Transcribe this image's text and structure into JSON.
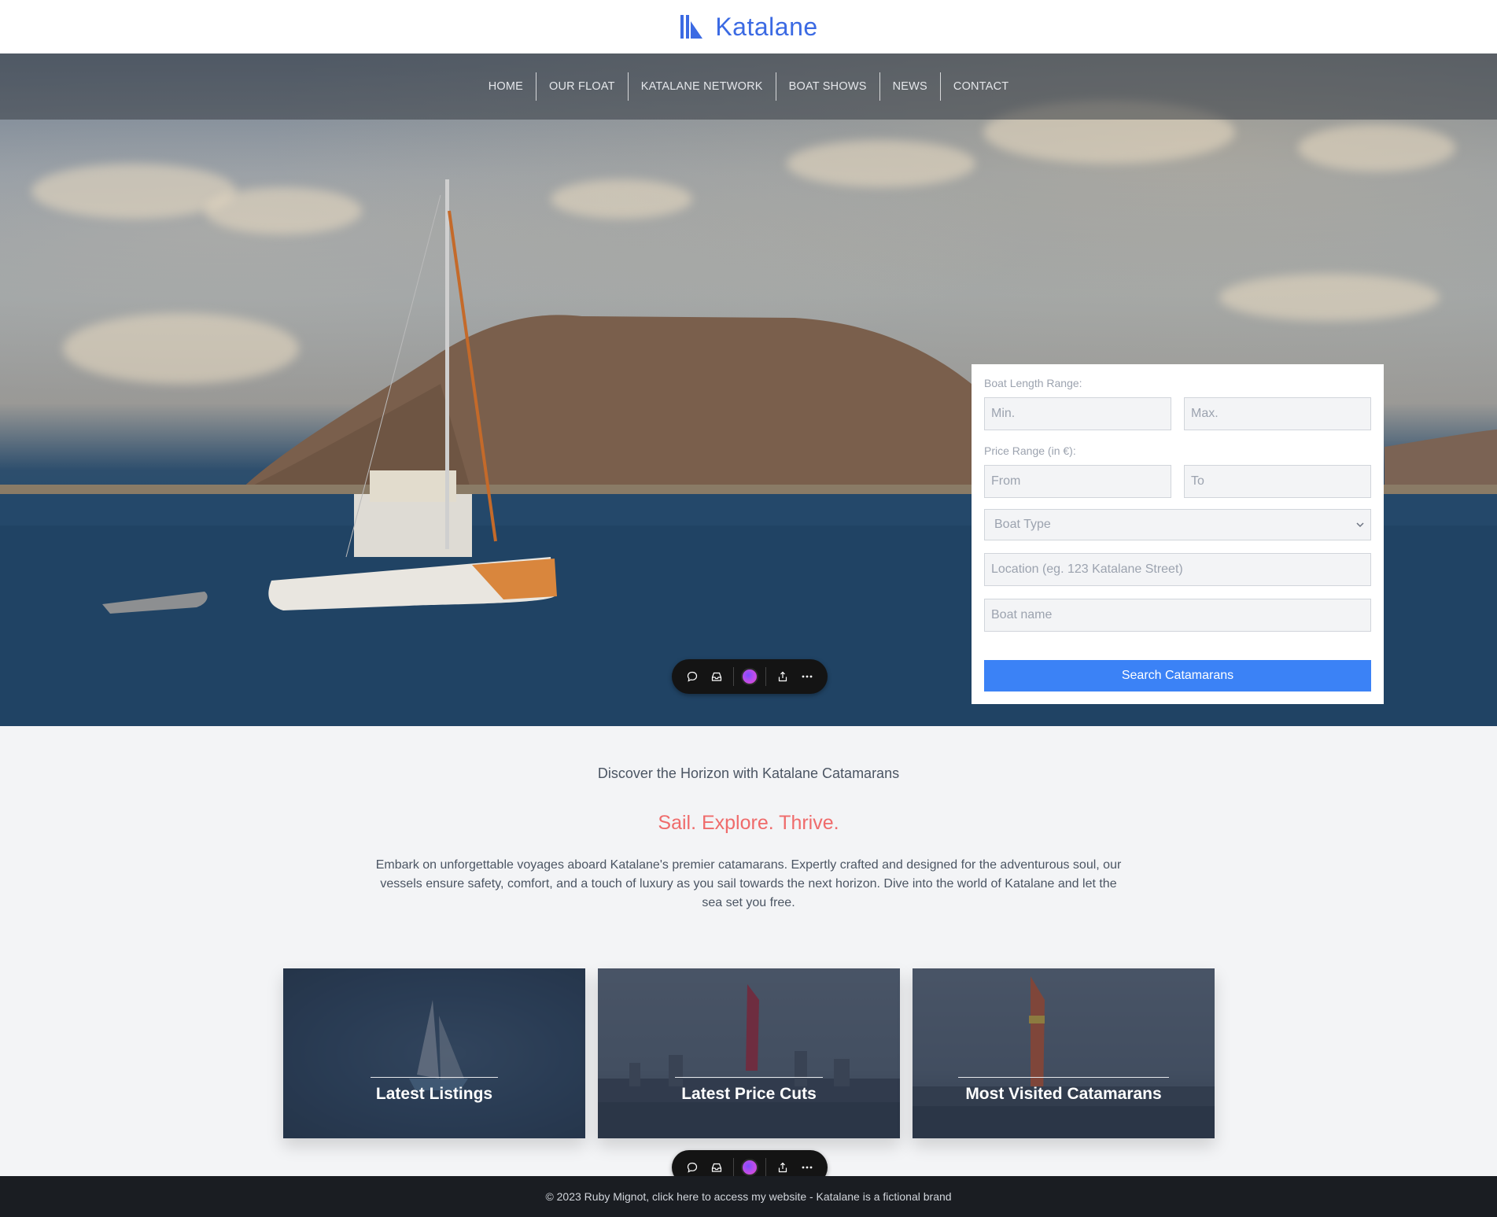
{
  "header": {
    "brand_name": "Katalane"
  },
  "nav": {
    "items": [
      {
        "label": "HOME"
      },
      {
        "label": "OUR FLOAT"
      },
      {
        "label": "KATALANE NETWORK"
      },
      {
        "label": "BOAT SHOWS"
      },
      {
        "label": "NEWS"
      },
      {
        "label": "CONTACT"
      }
    ]
  },
  "search": {
    "length_label": "Boat Length Range:",
    "length_min_placeholder": "Min.",
    "length_max_placeholder": "Max.",
    "price_label": "Price Range (in €):",
    "price_from_placeholder": "From",
    "price_to_placeholder": "To",
    "boat_type_selected": "Boat Type",
    "location_placeholder": "Location (eg. 123 Katalane Street)",
    "boat_name_placeholder": "Boat name",
    "button_label": "Search Catamarans"
  },
  "intro": {
    "subtitle": "Discover the Horizon with Katalane Catamarans",
    "title": "Sail. Explore. Thrive.",
    "body": "Embark on unforgettable voyages aboard Katalane's premier catamarans. Expertly crafted and designed for the adventurous soul, our vessels ensure safety, comfort, and a touch of luxury as you sail towards the next horizon. Dive into the world of Katalane and let the sea set you free."
  },
  "cards": [
    {
      "title": "Latest Listings"
    },
    {
      "title": "Latest Price Cuts"
    },
    {
      "title": "Most Visited Catamarans"
    }
  ],
  "toolbar": {
    "icons": [
      "comment-icon",
      "inbox-icon",
      "avatar-orb-icon",
      "share-icon",
      "more-icon"
    ]
  },
  "footer": {
    "text": "© 2023 Ruby Mignot, click here to access my website - Katalane is a fictional brand"
  },
  "colors": {
    "brand": "#3b6ae3",
    "accent_button": "#3b82f6",
    "headline": "#ef6b6b",
    "footer_bg": "#1a1d22"
  }
}
